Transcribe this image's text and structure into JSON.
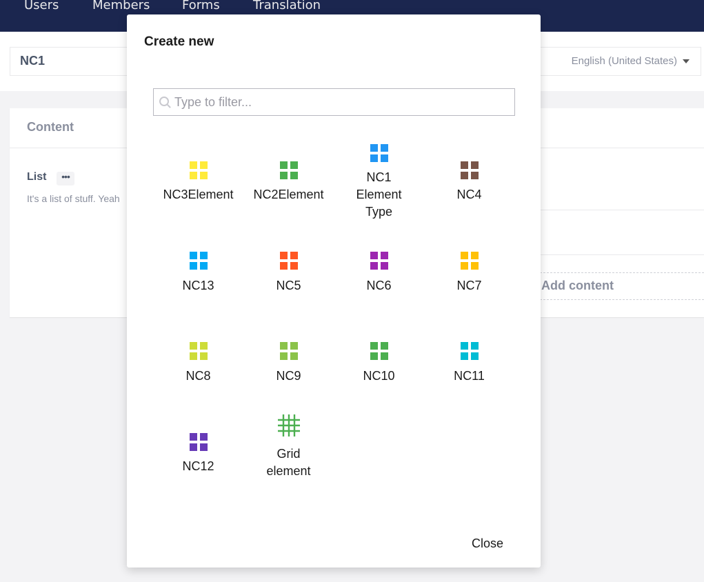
{
  "topnav": {
    "items": [
      {
        "label": "Users"
      },
      {
        "label": "Members"
      },
      {
        "label": "Forms"
      },
      {
        "label": "Translation"
      }
    ]
  },
  "header": {
    "node_name": "NC1",
    "culture": "English (United States)"
  },
  "content": {
    "group_title": "Content",
    "property_label": "List",
    "property_dots": "•••",
    "property_description": "It's a list of stuff. Yeah",
    "add_content": "Add content"
  },
  "modal": {
    "title": "Create new",
    "filter_placeholder": "Type to filter...",
    "close_label": "Close",
    "items": [
      {
        "label": "NC3Element",
        "icon": "grid-icon",
        "color": "#ffeb3b"
      },
      {
        "label": "NC2Element",
        "icon": "grid-icon",
        "color": "#4caf50"
      },
      {
        "label": "NC1\nElement\nType",
        "icon": "grid-icon",
        "color": "#2196f3"
      },
      {
        "label": "NC4",
        "icon": "grid-icon",
        "color": "#795548"
      },
      {
        "label": "NC13",
        "icon": "grid-icon",
        "color": "#03a9f4"
      },
      {
        "label": "NC5",
        "icon": "grid-icon",
        "color": "#ff5722"
      },
      {
        "label": "NC6",
        "icon": "grid-icon",
        "color": "#9c27b0"
      },
      {
        "label": "NC7",
        "icon": "grid-icon",
        "color": "#ffc107"
      },
      {
        "label": "NC8",
        "icon": "grid-icon",
        "color": "#cddc39"
      },
      {
        "label": "NC9",
        "icon": "grid-icon",
        "color": "#8bc34a"
      },
      {
        "label": "NC10",
        "icon": "grid-icon",
        "color": "#4caf50"
      },
      {
        "label": "NC11",
        "icon": "grid-icon",
        "color": "#00bcd4"
      },
      {
        "label": "NC12",
        "icon": "grid-icon",
        "color": "#673ab7"
      },
      {
        "label": "Grid\nelement",
        "icon": "hashtag-grid-icon",
        "color": "#4caf50"
      }
    ]
  }
}
